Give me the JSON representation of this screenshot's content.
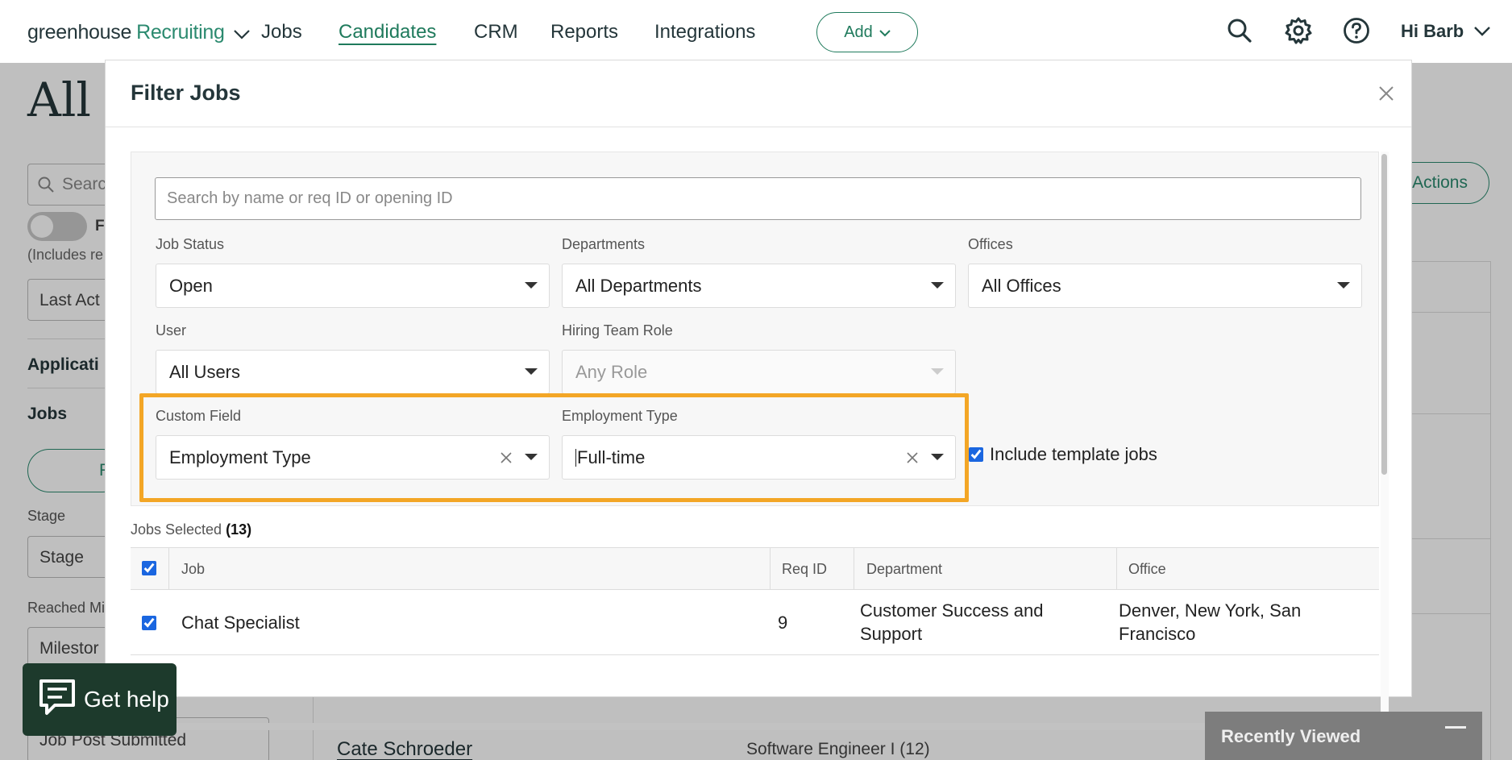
{
  "nav": {
    "logo_primary": "greenhouse",
    "logo_secondary": "Recruiting",
    "links": [
      "Jobs",
      "Candidates",
      "CRM",
      "Reports",
      "Integrations"
    ],
    "active_link": "Candidates",
    "add_label": "Add",
    "user_label": "Hi Barb",
    "accent_color": "#1f7a5c"
  },
  "background": {
    "heading": "All C",
    "search_placeholder": "Searc",
    "toggle_label": "F",
    "includes_note": "(Includes re",
    "last_activity_select": "Last Act",
    "applications_heading": "Applicati",
    "jobs_heading": "Jobs",
    "pill_label": "F",
    "stage_label": "Stage",
    "stage_select": "Stage",
    "reached_label": "Reached Mi",
    "milestone_select": "Milestor",
    "job_post_select": "Job Post Submitted",
    "bulk_actions": "Actions",
    "candidate_name": "Cate Schroeder",
    "candidate_job": "Software Engineer I (12)"
  },
  "modal": {
    "title": "Filter Jobs",
    "search_placeholder": "Search by name or req ID or opening ID",
    "job_status": {
      "label": "Job Status",
      "value": "Open"
    },
    "departments": {
      "label": "Departments",
      "value": "All Departments"
    },
    "offices": {
      "label": "Offices",
      "value": "All Offices"
    },
    "user": {
      "label": "User",
      "value": "All Users"
    },
    "hiring_team_role": {
      "label": "Hiring Team Role",
      "value": "Any Role"
    },
    "custom_field": {
      "label": "Custom Field",
      "value": "Employment Type"
    },
    "employment_type": {
      "label": "Employment Type",
      "value": "Full-time"
    },
    "include_template_jobs": {
      "label": "Include template jobs",
      "checked": true
    },
    "jobs_selected_label": "Jobs Selected",
    "jobs_selected_count": "(13)",
    "table": {
      "columns": [
        "Job",
        "Req ID",
        "Department",
        "Office"
      ],
      "rows": [
        {
          "job": "Chat Specialist",
          "req_id": "9",
          "department_line1": "Customer Success and",
          "department_line2": "Support",
          "office_line1": "Denver, New York, San",
          "office_line2": "Francisco",
          "checked": true
        }
      ]
    },
    "highlight_color": "#f3a626"
  },
  "help_widget": {
    "label": "Get help"
  },
  "recently_viewed": {
    "label": "Recently Viewed"
  }
}
